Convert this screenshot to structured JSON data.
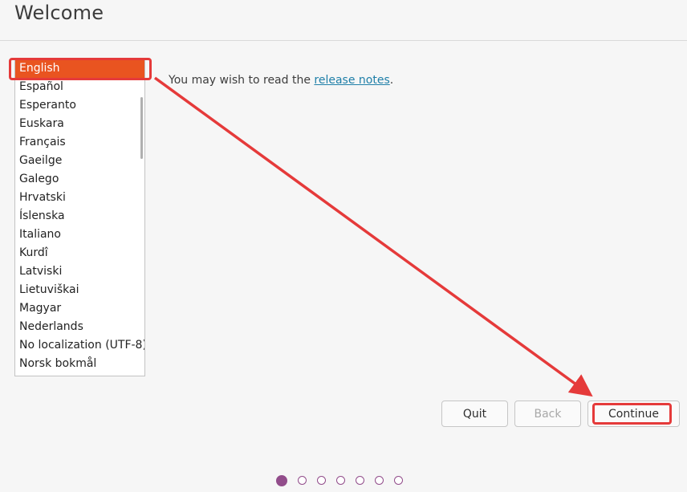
{
  "header": {
    "title": "Welcome"
  },
  "languages": {
    "selected": "English",
    "items": [
      "English",
      "Español",
      "Esperanto",
      "Euskara",
      "Français",
      "Gaeilge",
      "Galego",
      "Hrvatski",
      "Íslenska",
      "Italiano",
      "Kurdî",
      "Latviski",
      "Lietuviškai",
      "Magyar",
      "Nederlands",
      "No localization (UTF-8)",
      "Norsk bokmål"
    ]
  },
  "note": {
    "prefix": "You may wish to read the ",
    "link": "release notes",
    "suffix": "."
  },
  "buttons": {
    "quit": "Quit",
    "back": "Back",
    "continue": "Continue"
  },
  "progress": {
    "total_steps": 7,
    "current_step": 1
  },
  "colors": {
    "accent": "#e95420",
    "progress": "#924d8b",
    "annotation": "#e53a3a",
    "link": "#1f7fa8"
  }
}
